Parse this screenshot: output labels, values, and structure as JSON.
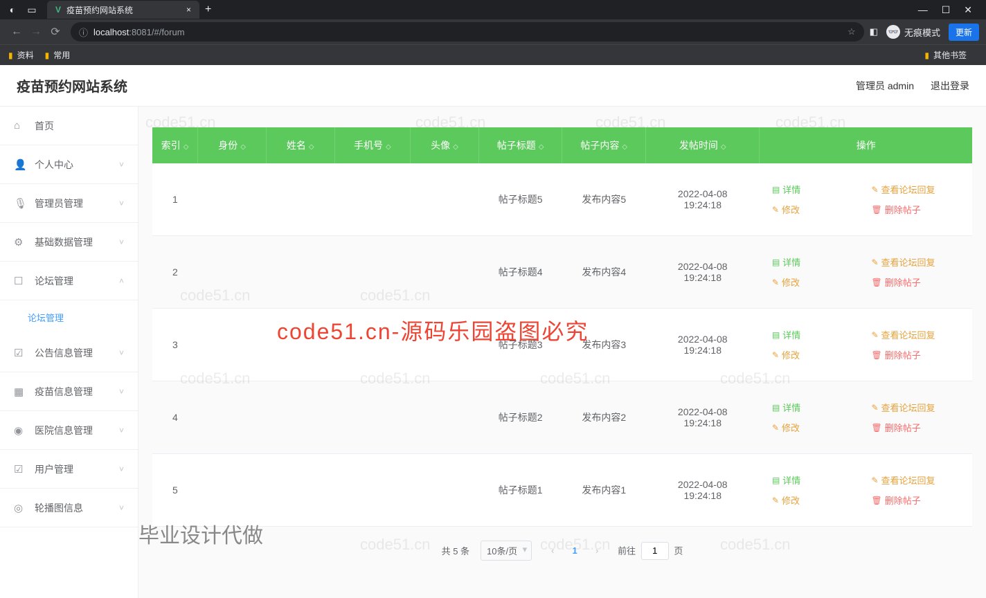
{
  "browser": {
    "tab_title": "疫苗预约网站系统",
    "tab_add": "+",
    "tab_close": "×",
    "win_min": "—",
    "win_max": "☐",
    "win_close": "✕",
    "url_prefix": "ⓘ",
    "url_host": "localhost",
    "url_port": ":8081/#/forum",
    "star": "☆",
    "ext": "◧",
    "incognito": "无痕模式",
    "update": "更新",
    "bookmarks": [
      "资料",
      "常用"
    ],
    "bookmark_other": "其他书签"
  },
  "app": {
    "title": "疫苗预约网站系统",
    "user_role": "管理员 admin",
    "logout": "退出登录"
  },
  "sidebar": {
    "items": [
      {
        "icon": "⌂",
        "label": "首页",
        "expandable": false
      },
      {
        "icon": "👤",
        "label": "个人中心",
        "expandable": true
      },
      {
        "icon": "🎙",
        "label": "管理员管理",
        "expandable": true
      },
      {
        "icon": "⚙",
        "label": "基础数据管理",
        "expandable": true
      },
      {
        "icon": "☐",
        "label": "论坛管理",
        "expandable": true,
        "expanded": true,
        "children": [
          "论坛管理"
        ]
      },
      {
        "icon": "☑",
        "label": "公告信息管理",
        "expandable": true
      },
      {
        "icon": "▦",
        "label": "疫苗信息管理",
        "expandable": true
      },
      {
        "icon": "◉",
        "label": "医院信息管理",
        "expandable": true
      },
      {
        "icon": "☑",
        "label": "用户管理",
        "expandable": true
      },
      {
        "icon": "◎",
        "label": "轮播图信息",
        "expandable": true
      }
    ]
  },
  "table": {
    "headers": [
      "索引",
      "身份",
      "姓名",
      "手机号",
      "头像",
      "帖子标题",
      "帖子内容",
      "发帖时间",
      "操作"
    ],
    "rows": [
      {
        "index": "1",
        "identity": "",
        "name": "",
        "phone": "",
        "avatar": "",
        "title": "帖子标题5",
        "content": "发布内容5",
        "time": "2022-04-08 19:24:18"
      },
      {
        "index": "2",
        "identity": "",
        "name": "",
        "phone": "",
        "avatar": "",
        "title": "帖子标题4",
        "content": "发布内容4",
        "time": "2022-04-08 19:24:18"
      },
      {
        "index": "3",
        "identity": "",
        "name": "",
        "phone": "",
        "avatar": "",
        "title": "帖子标题3",
        "content": "发布内容3",
        "time": "2022-04-08 19:24:18"
      },
      {
        "index": "4",
        "identity": "",
        "name": "",
        "phone": "",
        "avatar": "",
        "title": "帖子标题2",
        "content": "发布内容2",
        "time": "2022-04-08 19:24:18"
      },
      {
        "index": "5",
        "identity": "",
        "name": "",
        "phone": "",
        "avatar": "",
        "title": "帖子标题1",
        "content": "发布内容1",
        "time": "2022-04-08 19:24:18"
      }
    ],
    "ops": {
      "detail": "详情",
      "view_reply": "查看论坛回复",
      "edit": "修改",
      "delete": "删除帖子"
    }
  },
  "pagination": {
    "total": "共 5 条",
    "page_size": "10条/页",
    "current": "1",
    "goto_prefix": "前往",
    "goto_value": "1",
    "goto_suffix": "页"
  },
  "watermarks": {
    "red": "code51.cn-源码乐园盗图必究",
    "grey": "专业毕业设计代做",
    "faint": "code51.cn"
  }
}
